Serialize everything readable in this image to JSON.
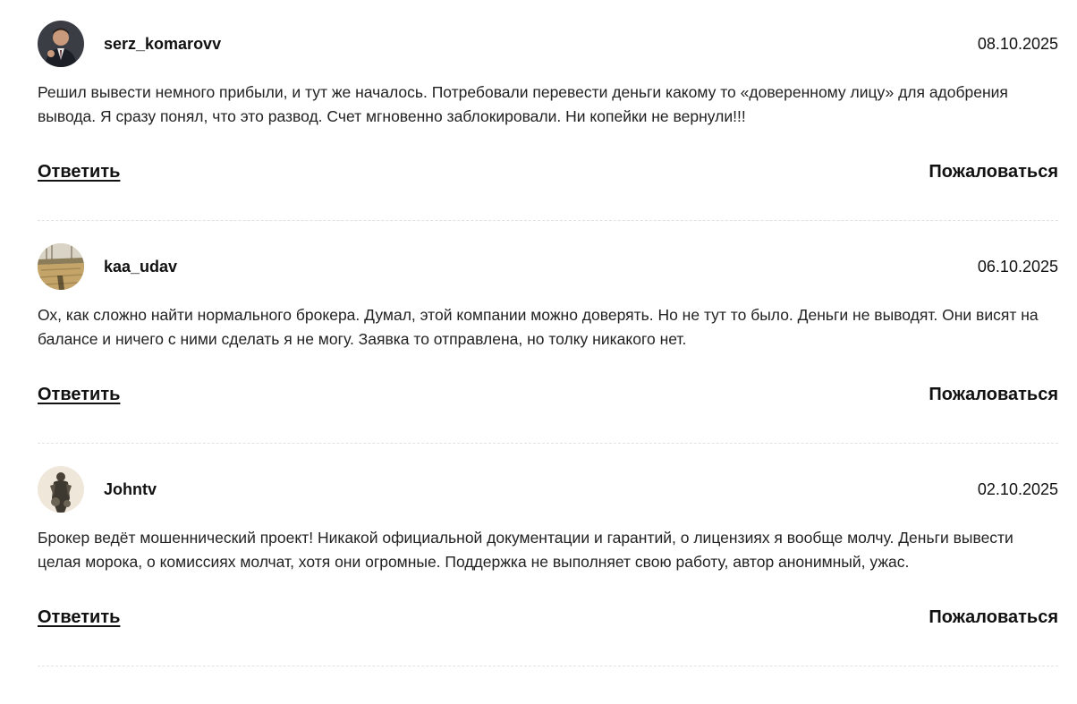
{
  "comments": [
    {
      "username": "serz_komarovv",
      "date": "08.10.2025",
      "text": "Решил вывести немного прибыли, и тут же началось. Потребовали перевести деньги какому то «доверенному лицу» для адобрения вывода. Я сразу понял, что это развод. Счет мгновенно заблокировали. Ни копейки не вернули!!!",
      "reply_label": "Ответить",
      "report_label": "Пожаловаться",
      "avatar_icon": "user-photo-avatar"
    },
    {
      "username": "kaa_udav",
      "date": "06.10.2025",
      "text": "Ох, как сложно найти нормального брокера. Думал, этой компании можно доверять. Но не тут то было. Деньги не выводят. Они висят на балансе и ничего с ними сделать я не могу. Заявка то отправлена, но толку никакого нет.",
      "reply_label": "Ответить",
      "report_label": "Пожаловаться",
      "avatar_icon": "landscape-photo-avatar"
    },
    {
      "username": "Johntv",
      "date": "02.10.2025",
      "text": "Брокер ведёт мошеннический проект! Никакой официальной документации и гарантий, о лицензиях я вообще молчу. Деньги вывести целая морока, о комиссиях молчат, хотя они огромные. Поддержка не выполняет свою работу, автор анонимный, ужас.",
      "reply_label": "Ответить",
      "report_label": "Пожаловаться",
      "avatar_icon": "figure-photo-avatar"
    }
  ]
}
